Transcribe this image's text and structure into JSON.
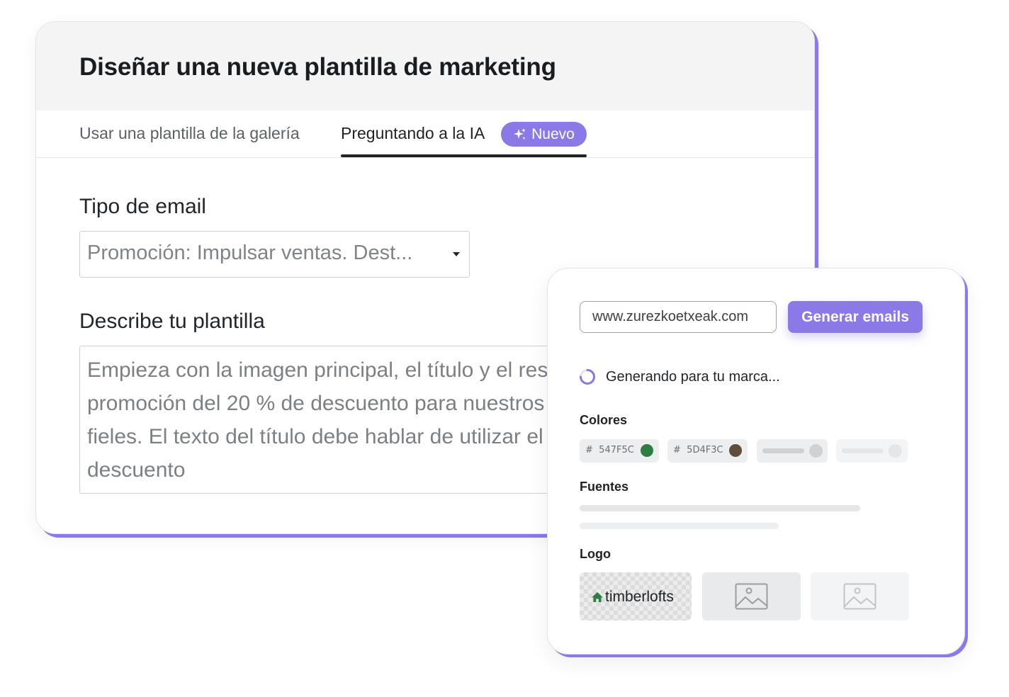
{
  "dialog": {
    "title": "Diseñar una nueva plantilla de marketing",
    "tabs": [
      {
        "label": "Usar una plantilla de la galería",
        "active": false
      },
      {
        "label": "Preguntando a la IA",
        "active": true,
        "badge": "Nuevo"
      }
    ],
    "email_type": {
      "label": "Tipo de email",
      "value": "Promoción: Impulsar ventas. Dest..."
    },
    "describe": {
      "label": "Describe tu plantilla",
      "placeholder": "Empieza con la imagen principal, el título y el resumen de la promoción del 20 % de descuento para nuestros clientes más fieles. El texto del título debe hablar de utilizar el 20 % de descuento"
    }
  },
  "brand_panel": {
    "url_value": "www.zurezkoetxeak.com",
    "generate_button": "Generar emails",
    "status_text": "Generando para tu marca...",
    "colors": {
      "label": "Colores",
      "swatches": [
        {
          "prefix": "#",
          "hex_label": "547F5C",
          "color": "#547F5C",
          "dot_color": "#2e7d45"
        },
        {
          "prefix": "#",
          "hex_label": "5D4F3C",
          "color": "#5D4F3C",
          "dot_color": "#5d4f3c"
        }
      ]
    },
    "fonts": {
      "label": "Fuentes"
    },
    "logo": {
      "label": "Logo",
      "logo_text": "timberlofts"
    }
  },
  "colors": {
    "accent": "#8a79e6",
    "header_bg": "#f3f4f3",
    "text_dark": "#1a1d20"
  }
}
